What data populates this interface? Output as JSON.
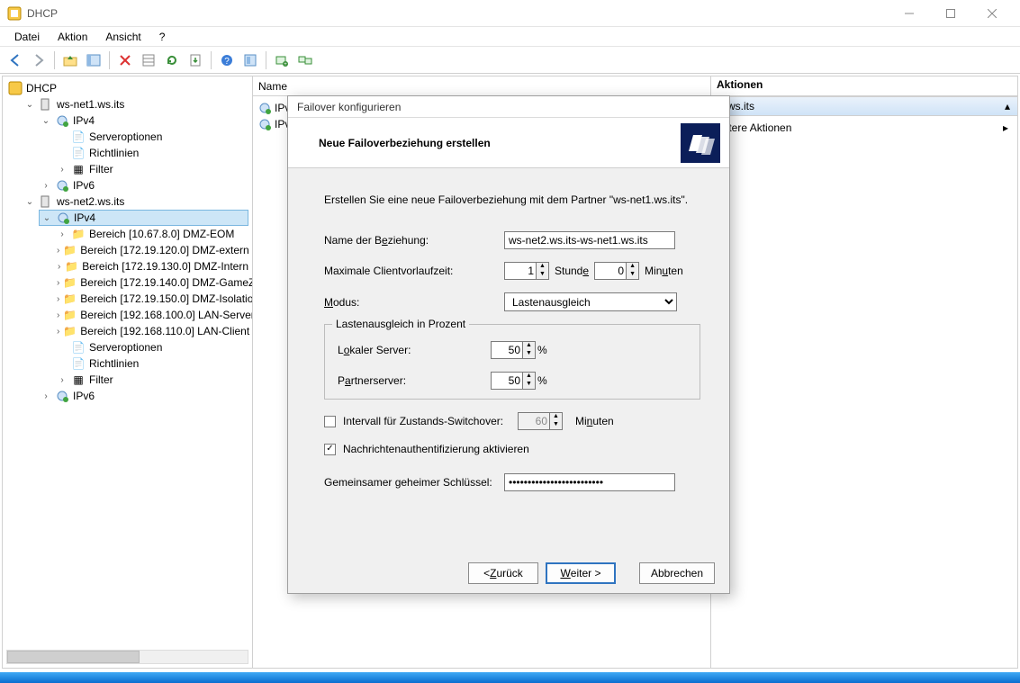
{
  "window": {
    "title": "DHCP",
    "menus": [
      "Datei",
      "Aktion",
      "Ansicht",
      "?"
    ]
  },
  "toolbar_icons": [
    "back-arrow-icon",
    "forward-arrow-icon",
    "up-folder-icon",
    "properties-grid-icon",
    "delete-x-icon",
    "copy-icon",
    "paste-icon",
    "refresh-icon",
    "export-icon",
    "help-icon",
    "settings-sheet-icon",
    "monitor-add-icon",
    "monitor-pair-icon"
  ],
  "tree": {
    "root": "DHCP",
    "server1": {
      "name": "ws-net1.ws.its",
      "ipv4": "IPv4",
      "ipv4_children": [
        "Serveroptionen",
        "Richtlinien",
        "Filter"
      ],
      "ipv6": "IPv6"
    },
    "server2": {
      "name": "ws-net2.ws.its",
      "ipv4": "IPv4",
      "scopes": [
        "Bereich [10.67.8.0] DMZ-EOM",
        "Bereich [172.19.120.0] DMZ-extern",
        "Bereich [172.19.130.0] DMZ-Intern",
        "Bereich [172.19.140.0] DMZ-GameZ",
        "Bereich [172.19.150.0] DMZ-Isolatio",
        "Bereich [192.168.100.0] LAN-Server",
        "Bereich [192.168.110.0] LAN-Client"
      ],
      "tail": [
        "Serveroptionen",
        "Richtlinien",
        "Filter"
      ],
      "ipv6": "IPv6"
    }
  },
  "list": {
    "header": "Name",
    "rows": [
      "IPv",
      "IPv"
    ]
  },
  "actions": {
    "header": "Aktionen",
    "section_header_suffix": "2.ws.its",
    "item1": "eitere Aktionen"
  },
  "dialog": {
    "title": "Failover konfigurieren",
    "header": "Neue Failoverbeziehung erstellen",
    "intro": "Erstellen Sie eine neue Failoverbeziehung mit dem Partner \"ws-net1.ws.its\".",
    "name_label_pre": "Name der B",
    "name_label_hot": "e",
    "name_label_post": "ziehung:",
    "name_value": "ws-net2.ws.its-ws-net1.ws.its",
    "mcl_label": "Maximale Clientvorlaufzeit:",
    "mcl_hours": "1",
    "mcl_hours_unit_pre": "Stund",
    "mcl_hours_unit_hot": "e",
    "mcl_minutes": "0",
    "mcl_minutes_unit_pre": "Min",
    "mcl_minutes_unit_hot": "u",
    "mcl_minutes_unit_post": "ten",
    "mode_label_hot": "M",
    "mode_label_post": "odus:",
    "mode_value": "Lastenausgleich",
    "lb_legend": "Lastenausgleich in Prozent",
    "lb_local_pre": "L",
    "lb_local_hot": "o",
    "lb_local_post": "kaler Server:",
    "lb_local_val": "50",
    "lb_partner_pre": "P",
    "lb_partner_hot": "a",
    "lb_partner_post": "rtnerserver:",
    "lb_partner_val": "50",
    "pct": "%",
    "switchover_label": "Intervall für Zustands-Switchover:",
    "switchover_val": "60",
    "switchover_unit_pre": "Mi",
    "switchover_unit_hot": "n",
    "switchover_unit_post": "uten",
    "auth_label": "Nachrichtenauthentifizierung aktivieren",
    "secret_label": "Gemeinsamer geheimer Schlüssel:",
    "secret_value": "•••••••••••••••••••••••••",
    "btn_back_pre": "< ",
    "btn_back_hot": "Z",
    "btn_back_post": "urück",
    "btn_next_pre": "",
    "btn_next_hot": "W",
    "btn_next_post": "eiter >",
    "btn_cancel": "Abbrechen"
  }
}
